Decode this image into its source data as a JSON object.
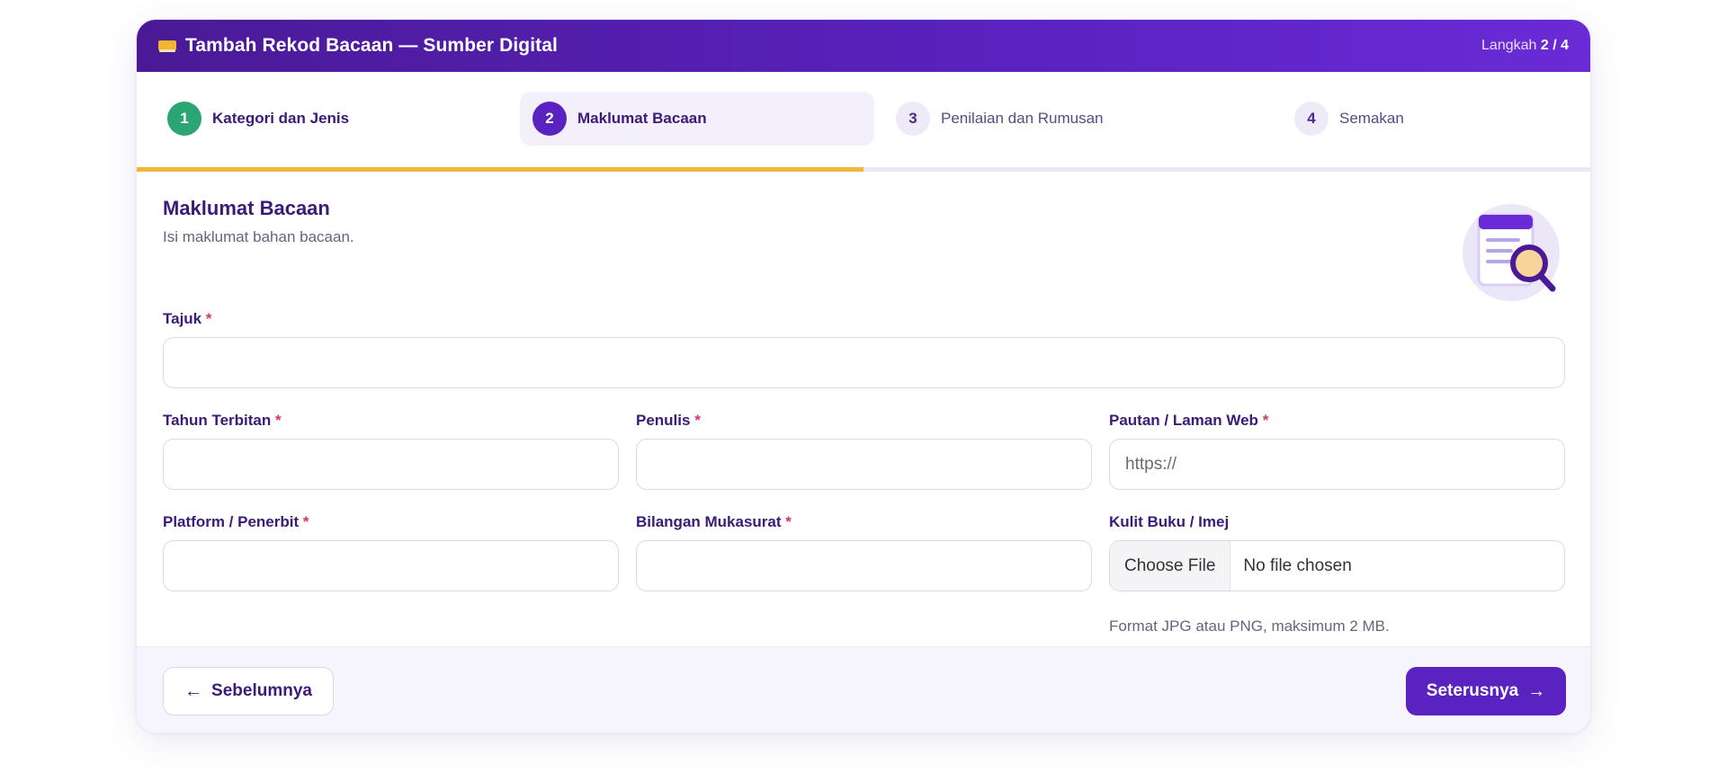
{
  "header": {
    "title": "Tambah Rekod Bacaan — Sumber Digital",
    "step_prefix": "Langkah",
    "step_current": "2 / 4"
  },
  "stepper": {
    "steps": [
      {
        "num": "1",
        "label": "Kategori dan Jenis",
        "state": "done"
      },
      {
        "num": "2",
        "label": "Maklumat Bacaan",
        "state": "current"
      },
      {
        "num": "3",
        "label": "Penilaian dan Rumusan",
        "state": "todo"
      },
      {
        "num": "4",
        "label": "Semakan",
        "state": "todo"
      }
    ],
    "progress": 0.5
  },
  "section": {
    "title": "Maklumat Bacaan",
    "subtitle": "Isi maklumat bahan bacaan."
  },
  "form": {
    "tajuk": {
      "label": "Tajuk",
      "required": "*",
      "value": "",
      "placeholder": ""
    },
    "tahun": {
      "label": "Tahun Terbitan",
      "required": "*",
      "value": "",
      "placeholder": ""
    },
    "penulis": {
      "label": "Penulis",
      "required": "*",
      "value": "",
      "placeholder": ""
    },
    "pautan": {
      "label": "Pautan / Laman Web",
      "required": "*",
      "value": "",
      "placeholder": "https://"
    },
    "platform": {
      "label": "Platform / Penerbit",
      "required": "*",
      "value": "",
      "placeholder": ""
    },
    "mukasurat": {
      "label": "Bilangan Mukasurat",
      "required": "*",
      "value": "",
      "placeholder": ""
    },
    "kulit": {
      "label": "Kulit Buku / Imej",
      "button": "Choose File",
      "file_name": "No file chosen",
      "hint": "Format JPG atau PNG, maksimum 2 MB."
    }
  },
  "footer": {
    "prev_label": "Sebelumnya",
    "next_label": "Seterusnya",
    "prev_icon": "arrow-left-icon",
    "next_icon": "arrow-right-icon"
  },
  "colors": {
    "primary": "#5a22c0",
    "accent": "#f1b73a",
    "success": "#2ba673",
    "required": "#d6336c"
  }
}
